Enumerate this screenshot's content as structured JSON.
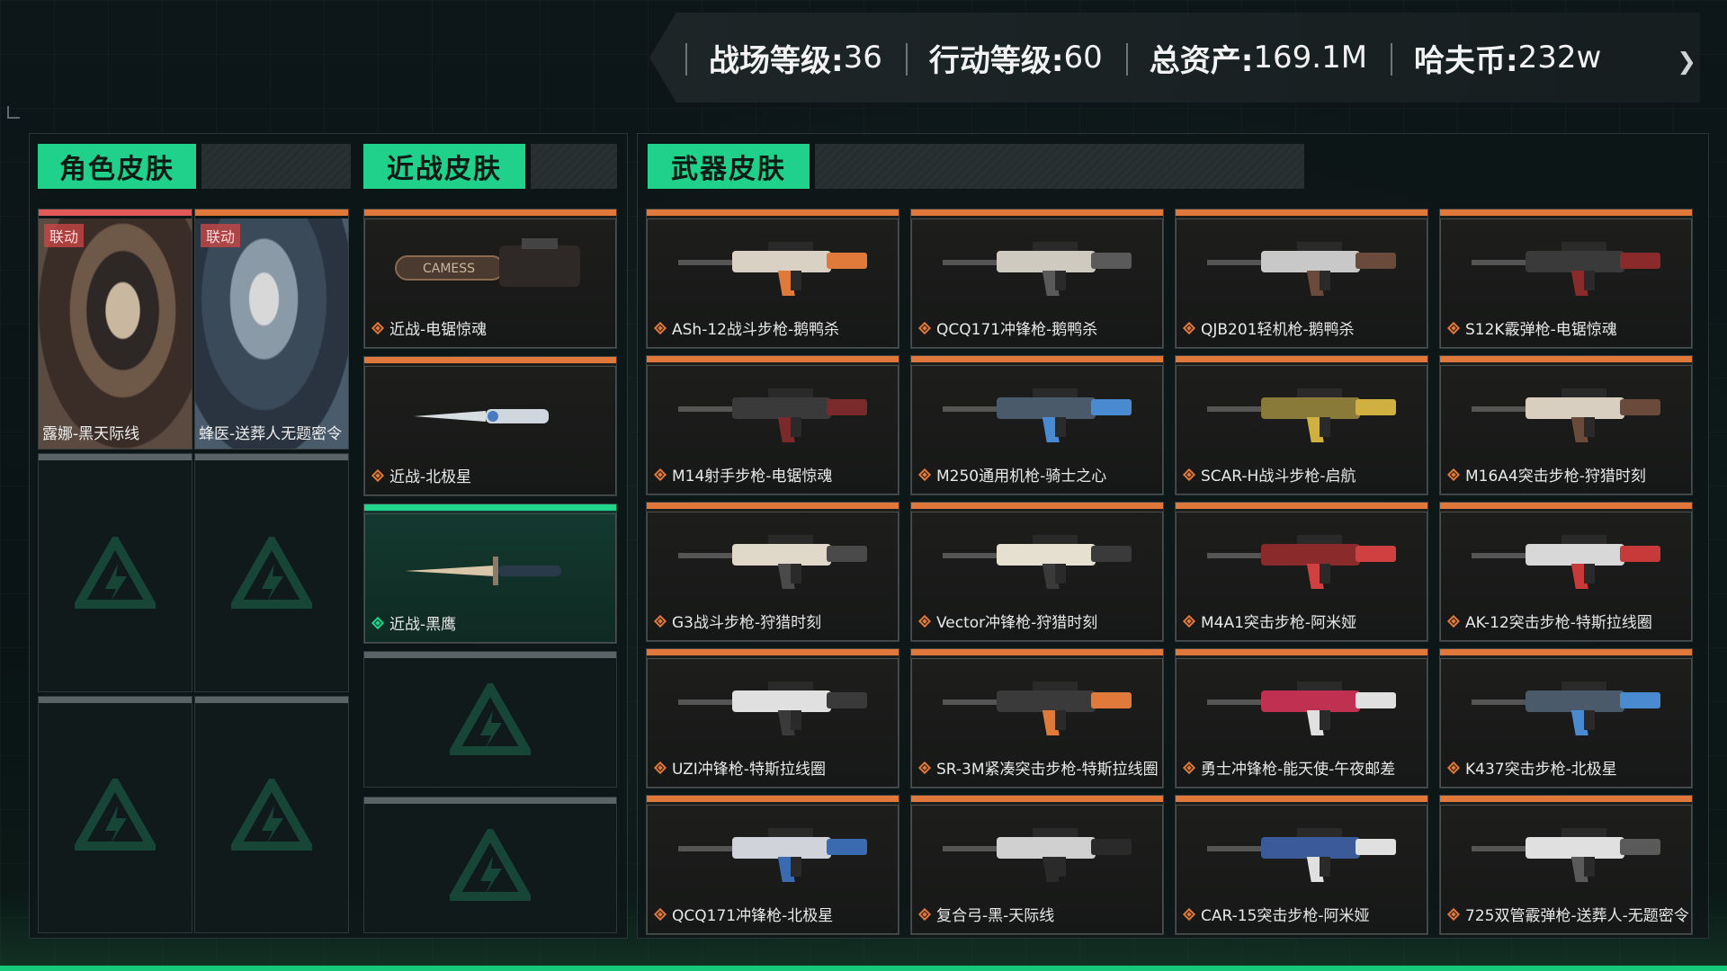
{
  "stats": [
    {
      "label": "战场等级:",
      "value": "36"
    },
    {
      "label": "行动等级:",
      "value": "60"
    },
    {
      "label": "总资产:",
      "value": "169.1M"
    },
    {
      "label": "哈夫币:",
      "value": "232w"
    }
  ],
  "sections": {
    "character": "角色皮肤",
    "melee": "近战皮肤",
    "weapon": "武器皮肤"
  },
  "characters": [
    {
      "name": "露娜-黑天际线",
      "badge": "联动"
    },
    {
      "name": "蜂医-送葬人无题密令",
      "badge": "联动"
    }
  ],
  "melee": [
    {
      "name": "近战-电锯惊魂",
      "rarity": "orange"
    },
    {
      "name": "近战-北极星",
      "rarity": "orange"
    },
    {
      "name": "近战-黑鹰",
      "rarity": "green"
    }
  ],
  "weapons": [
    "ASh-12战斗步枪-鹅鸭杀",
    "QCQ171冲锋枪-鹅鸭杀",
    "QJB201轻机枪-鹅鸭杀",
    "S12K霰弹枪-电锯惊魂",
    "M14射手步枪-电锯惊魂",
    "M250通用机枪-骑士之心",
    "SCAR-H战斗步枪-启航",
    "M16A4突击步枪-狩猎时刻",
    "G3战斗步枪-狩猎时刻",
    "Vector冲锋枪-狩猎时刻",
    "M4A1突击步枪-阿米娅",
    "AK-12突击步枪-特斯拉线圈",
    "UZI冲锋枪-特斯拉线圈",
    "SR-3M紧凑突击步枪-特斯拉线圈",
    "勇士冲锋枪-能天使-午夜邮差",
    "K437突击步枪-北极星",
    "QCQ171冲锋枪-北极星",
    "复合弓-黑-天际线",
    "CAR-15突击步枪-阿米娅",
    "725双管霰弹枪-送葬人-无题密令"
  ],
  "colors": {
    "accent_green": "#1fd18a",
    "rarity_orange": "#e0773b",
    "rarity_green": "#21d48c",
    "character_bar_red": "#e05a5a"
  }
}
